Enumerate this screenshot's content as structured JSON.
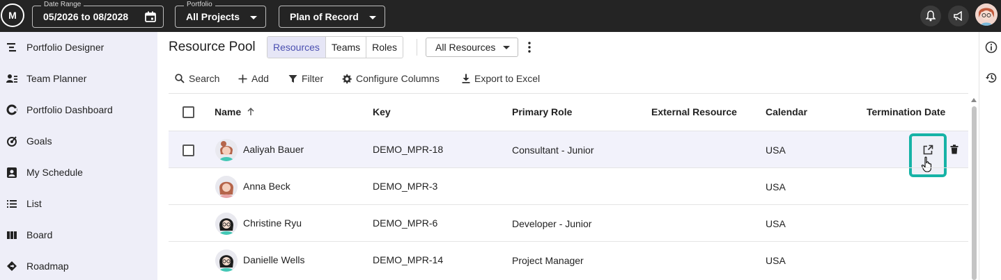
{
  "topbar": {
    "logo_text": "M",
    "date_range": {
      "legend": "Date Range",
      "value": "05/2026 to 08/2028"
    },
    "portfolio": {
      "legend": "Portfolio",
      "value": "All Projects"
    },
    "plan": {
      "value": "Plan of Record"
    }
  },
  "sidebar": {
    "items": [
      {
        "label": "Portfolio Designer",
        "icon": "portfolio-designer-icon"
      },
      {
        "label": "Team Planner",
        "icon": "team-planner-icon"
      },
      {
        "label": "Portfolio Dashboard",
        "icon": "dashboard-icon"
      },
      {
        "label": "Goals",
        "icon": "goals-icon"
      },
      {
        "label": "My Schedule",
        "icon": "schedule-icon"
      },
      {
        "label": "List",
        "icon": "list-icon"
      },
      {
        "label": "Board",
        "icon": "board-icon"
      },
      {
        "label": "Roadmap",
        "icon": "roadmap-icon"
      }
    ]
  },
  "main": {
    "title": "Resource Pool",
    "tabs": [
      {
        "label": "Resources",
        "active": true
      },
      {
        "label": "Teams",
        "active": false
      },
      {
        "label": "Roles",
        "active": false
      }
    ],
    "filter_select": "All Resources",
    "toolbar": {
      "search": "Search",
      "add": "Add",
      "filter": "Filter",
      "configure": "Configure Columns",
      "export": "Export to Excel"
    },
    "table": {
      "headers": {
        "name": "Name",
        "key": "Key",
        "role": "Primary Role",
        "external": "External Resource",
        "calendar": "Calendar",
        "termination": "Termination Date"
      },
      "rows": [
        {
          "name": "Aaliyah Bauer",
          "key": "DEMO_MPR-18",
          "role": "Consultant - Junior",
          "external": "",
          "calendar": "USA",
          "termination": ""
        },
        {
          "name": "Anna Beck",
          "key": "DEMO_MPR-3",
          "role": "",
          "external": "",
          "calendar": "USA",
          "termination": ""
        },
        {
          "name": "Christine Ryu",
          "key": "DEMO_MPR-6",
          "role": "Developer - Junior",
          "external": "",
          "calendar": "USA",
          "termination": ""
        },
        {
          "name": "Danielle Wells",
          "key": "DEMO_MPR-14",
          "role": "Project Manager",
          "external": "",
          "calendar": "USA",
          "termination": ""
        }
      ]
    }
  },
  "colors": {
    "topbar": "#242424",
    "sidebar": "#eeeef8",
    "accent": "#4a4fb0",
    "focus": "#16b3a6"
  }
}
